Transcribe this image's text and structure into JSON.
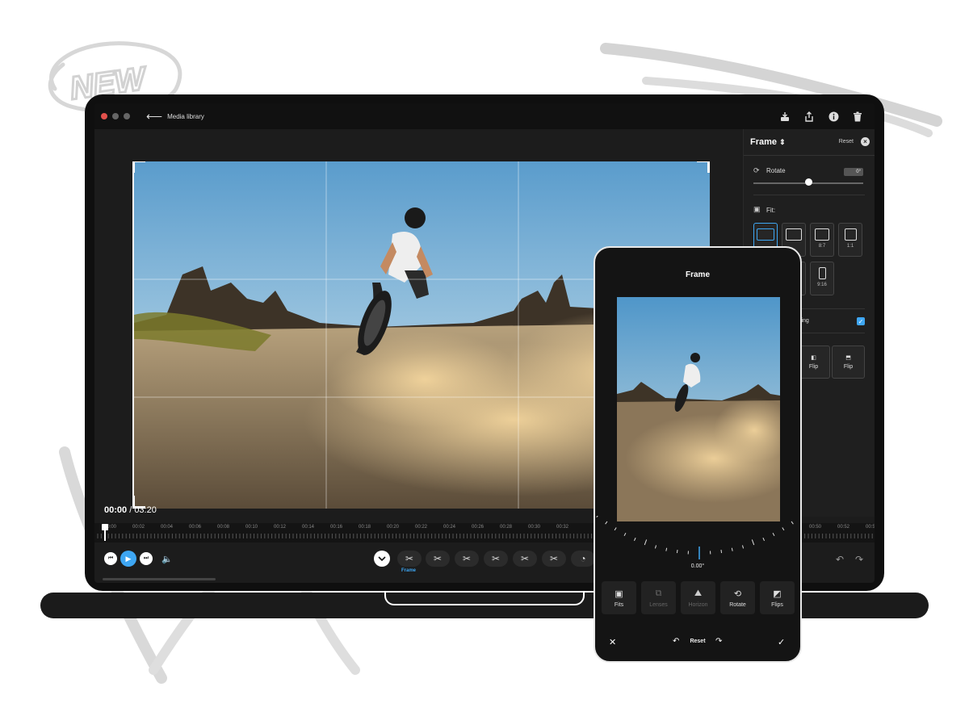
{
  "decoration": {
    "badge_text": "NEW"
  },
  "window": {
    "back_label": "Media library",
    "toolbar_icons": [
      "download-icon",
      "share-icon",
      "info-icon",
      "trash-icon"
    ]
  },
  "player": {
    "current_time": "00:00",
    "separator": " / ",
    "duration": "03:20",
    "ruler_labels": [
      "00:00",
      "00:02",
      "00:04",
      "00:06",
      "00:08",
      "00:10",
      "00:12",
      "00:14",
      "00:16",
      "00:18",
      "00:20",
      "00:22",
      "00:24",
      "00:26",
      "00:28",
      "00:30",
      "00:32",
      "00:50",
      "00:52",
      "00:5"
    ],
    "active_tool_label": "Frame"
  },
  "panel": {
    "title": "Frame",
    "title_arrow": "⇕",
    "reset_label": "Reset",
    "rotate_label": "Rotate",
    "rotate_value": "0°",
    "rotate_level": 0.5,
    "fit_label": "Fit:",
    "fit_options": [
      "",
      "",
      "8:7",
      "1:1",
      "",
      "9:16"
    ],
    "leveling_label": "eling",
    "flip_labels": [
      "Flip",
      "Flip"
    ]
  },
  "phone": {
    "title": "Frame",
    "degree": "0.00°",
    "tools": [
      {
        "label": "Fits",
        "icon": "fits-icon",
        "enabled": true
      },
      {
        "label": "Lenses",
        "icon": "lenses-icon",
        "enabled": false
      },
      {
        "label": "Horizon",
        "icon": "horizon-icon",
        "enabled": false
      },
      {
        "label": "Rotate",
        "icon": "rotate-icon",
        "enabled": true
      },
      {
        "label": "Flips",
        "icon": "flips-icon",
        "enabled": true
      }
    ],
    "reset_label": "Reset"
  },
  "colors": {
    "accent": "#3ea6f2",
    "close_dot": "#e2504b"
  }
}
